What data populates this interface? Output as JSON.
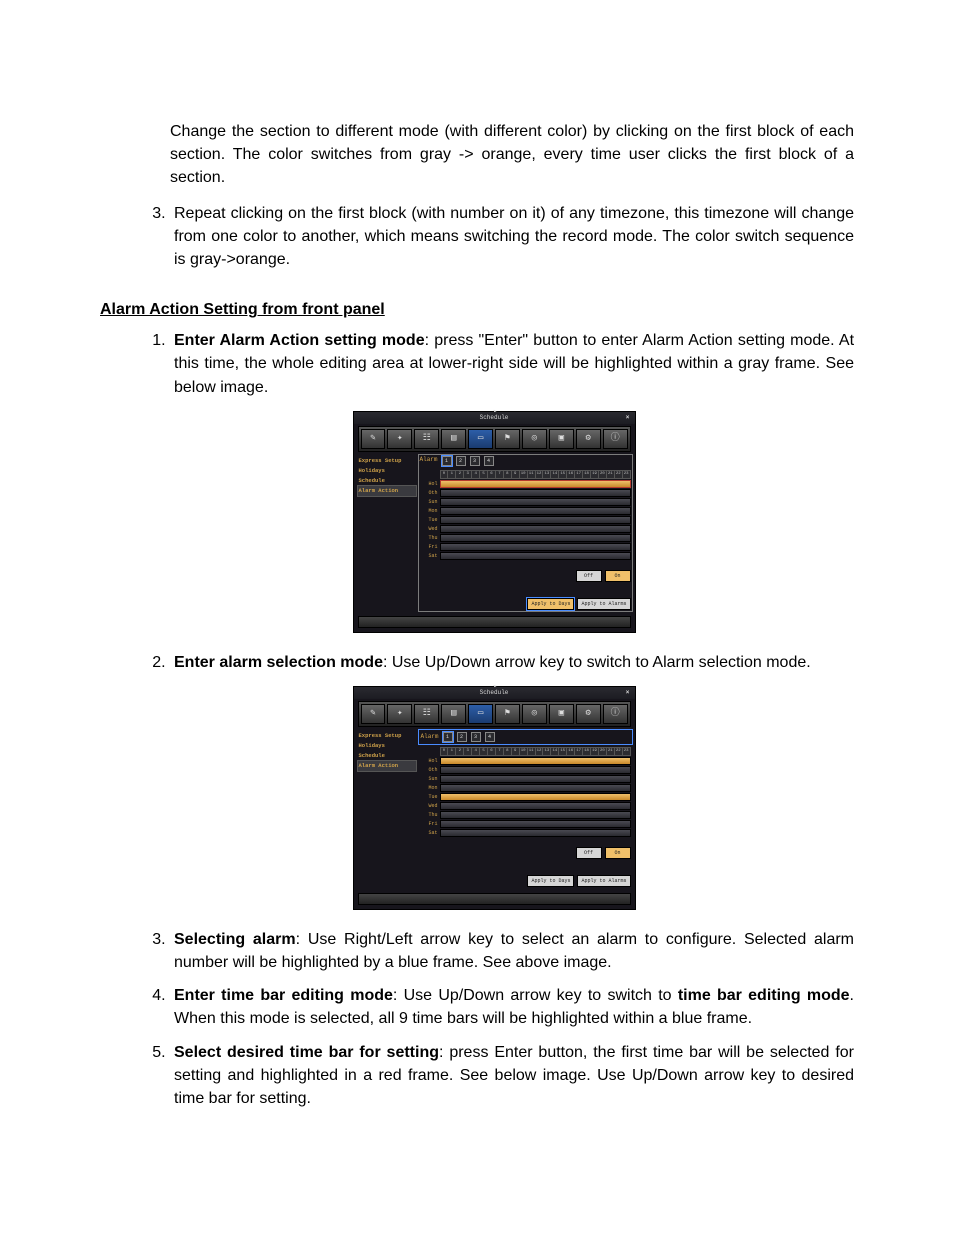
{
  "intro": {
    "p1": "Change the section to different mode (with different color) by clicking on the first block of each section. The color switches from gray -> orange, every time user clicks the first block of a section.",
    "p3_pre_num": "3.",
    "p3": "Repeat clicking on the first block (with number on it) of any timezone, this timezone will change from one color to another, which means switching the record mode. The color switch sequence is gray->orange."
  },
  "section_heading": "Alarm Action Setting from front panel",
  "steps": {
    "s1_bold": "Enter Alarm Action setting mode",
    "s1_rest": ": press \"Enter\" button to enter Alarm Action setting mode. At this time, the whole editing area at lower-right side will be highlighted within a gray frame. See below image.",
    "s2_bold": "Enter alarm selection mode",
    "s2_rest": ": Use Up/Down arrow key to switch to Alarm selection mode.",
    "s3_bold": "Selecting alarm",
    "s3_rest": ": Use Right/Left arrow key to select an alarm to configure. Selected alarm number will be highlighted by a blue frame. See above image.",
    "s4_bold": "Enter time bar editing mode",
    "s4_mid": ": Use Up/Down arrow key to switch to ",
    "s4_bold2": "time bar editing mode",
    "s4_rest": ". When this mode is selected, all 9 time bars will be highlighted within a blue frame.",
    "s5_bold": "Select desired time bar for setting",
    "s5_rest": ": press Enter button, the first time bar will be selected for setting and highlighted in a red frame. See below image. Use Up/Down arrow key to desired time bar for setting."
  },
  "window": {
    "title": "Schedule",
    "close": "×",
    "sidebar": [
      "Express Setup",
      "Holidays",
      "Schedule",
      "Alarm Action"
    ],
    "alarm_label": "Alarm",
    "alarm_nums": [
      "1",
      "2",
      "3",
      "4"
    ],
    "hours": [
      "0",
      "1",
      "2",
      "3",
      "4",
      "5",
      "6",
      "7",
      "8",
      "9",
      "10",
      "11",
      "12",
      "13",
      "14",
      "15",
      "16",
      "17",
      "18",
      "19",
      "20",
      "21",
      "22",
      "23"
    ],
    "days": [
      "Hol",
      "Oth",
      "Sun",
      "Mon",
      "Tue",
      "Wed",
      "Thu",
      "Fri",
      "Sat"
    ],
    "off": "Off",
    "on": "On",
    "apply_days": "Apply to Days",
    "apply_alarms": "Apply to Alarms"
  },
  "page_number": " "
}
